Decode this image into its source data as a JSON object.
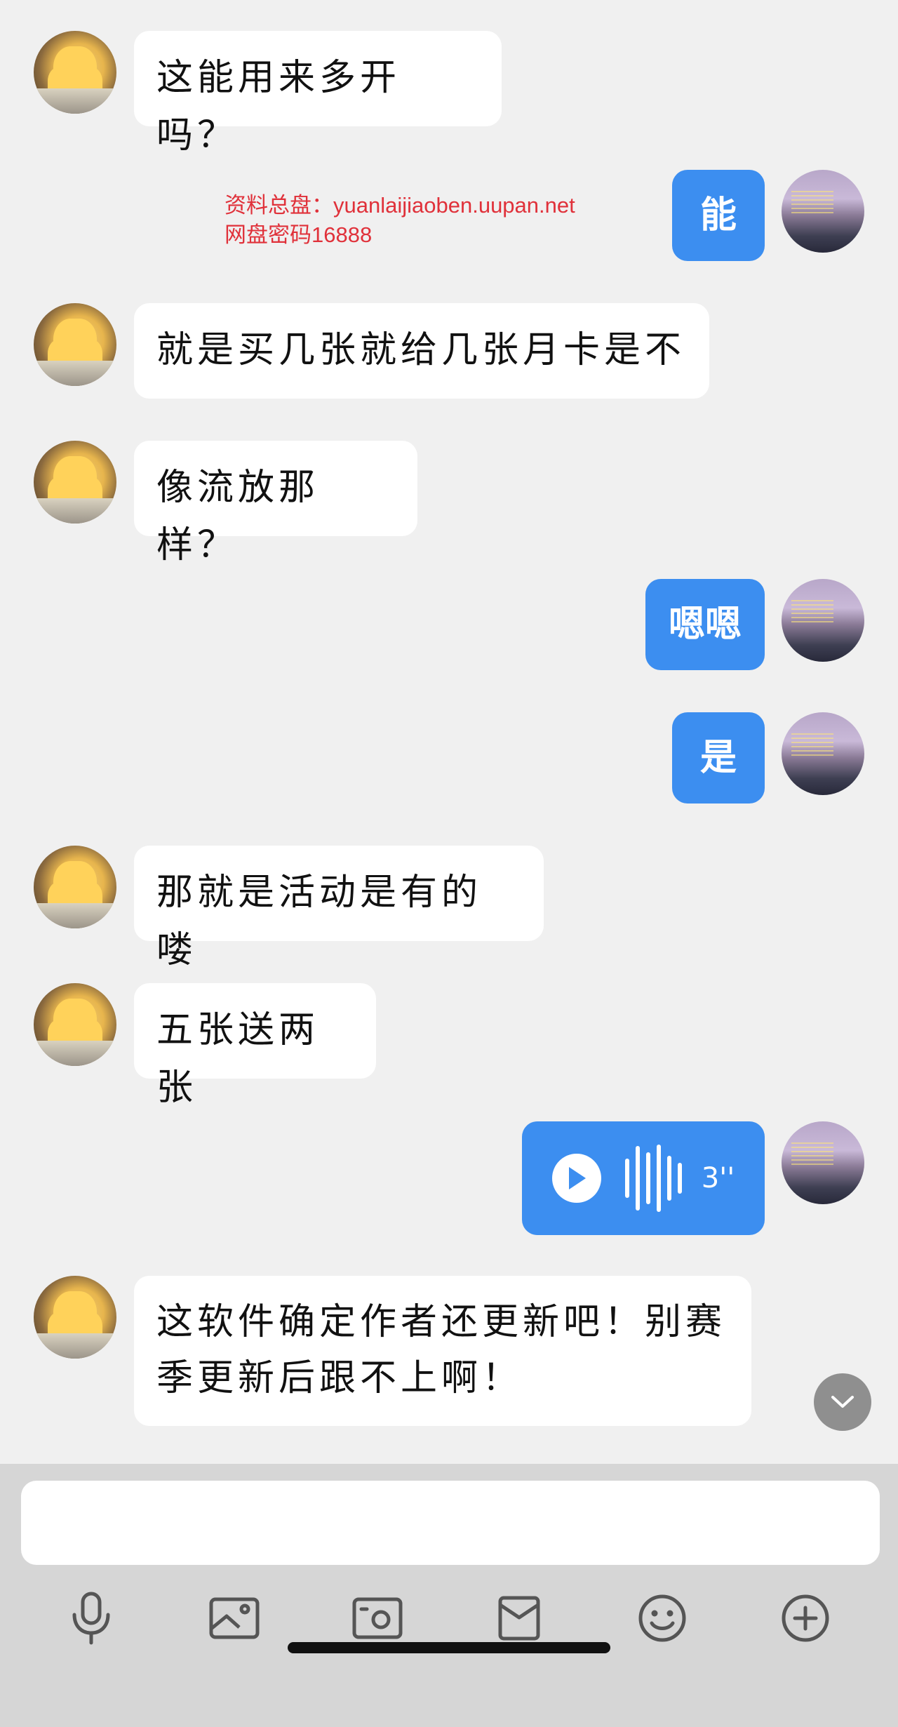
{
  "watermark": {
    "line1": "资料总盘：yuanlaijiaoben.uupan.net",
    "line2": "网盘密码16888"
  },
  "messages": [
    {
      "sender": "peer",
      "text": "这能用来多开吗？"
    },
    {
      "sender": "me",
      "text": "能"
    },
    {
      "sender": "peer",
      "text": "就是买几张就给几张月卡是不"
    },
    {
      "sender": "peer",
      "text": "像流放那样？"
    },
    {
      "sender": "me",
      "text": "嗯嗯"
    },
    {
      "sender": "me",
      "text": "是"
    },
    {
      "sender": "peer",
      "text": "那就是活动是有的喽"
    },
    {
      "sender": "peer",
      "text": "五张送两张"
    },
    {
      "sender": "me",
      "type": "voice",
      "duration": "3''"
    },
    {
      "sender": "peer",
      "text_line1": "这软件确定作者还更新吧！别赛",
      "text_line2": "季更新后跟不上啊！"
    }
  ],
  "colors": {
    "my_bubble": "#3c8ef0",
    "peer_bubble": "#ffffff",
    "chat_background": "#f0f0f0",
    "composer_background": "#d6d6d6",
    "watermark": "#e0313a"
  },
  "toolbar": {
    "icons": [
      "microphone-icon",
      "photo-icon",
      "camera-icon",
      "red-packet-icon",
      "emoji-icon",
      "plus-icon"
    ]
  }
}
